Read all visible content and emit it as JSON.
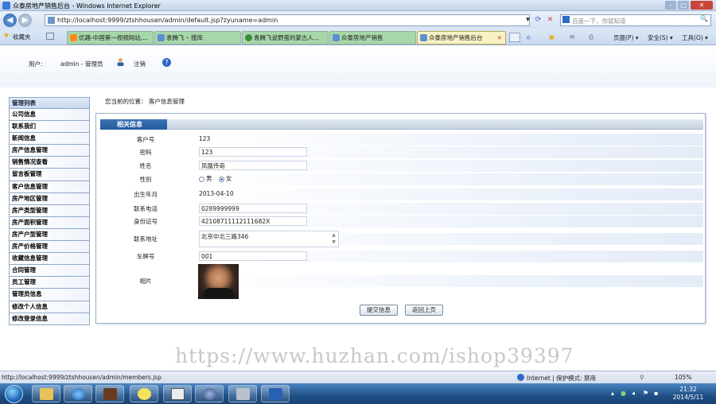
{
  "window": {
    "title": "众泰房地产销售后台 - Windows Internet Explorer",
    "min": "–",
    "max": "□",
    "close": "✕"
  },
  "address": {
    "url": "http://localhost:9999/ztshhousen/admin/default.jsp?zyuname=admin",
    "search_placeholder": "百度一下，你就知道",
    "back": "◀",
    "forward": "▶",
    "dropdown": "▾",
    "refresh": "⟳",
    "stop": "✕",
    "search_icon": "🔍"
  },
  "favorites": {
    "label": "收藏夹"
  },
  "tabs": [
    {
      "label": "优趣-中国第一视频网站,...",
      "color": "#a6d7a8"
    },
    {
      "label": "袁腾飞 – 搜库",
      "color": "#a6d7a8"
    },
    {
      "label": "袁腾飞说野蛮的蒙古人...",
      "color": "#a6d7a8"
    },
    {
      "label": "众泰房地产销售",
      "color": "#a6d7a8"
    },
    {
      "label": "众泰房地产销售后台",
      "color": "#f7f1c3",
      "active": true
    }
  ],
  "tab_close": "✕",
  "toolbar": {
    "page": "页面(P) ▾",
    "safety": "安全(S) ▾",
    "tools": "工具(O) ▾"
  },
  "header": {
    "user_label": "用户:",
    "user_value": "admin - 管理员",
    "logout": "注销",
    "help": "?"
  },
  "sidebar": {
    "title": "管理列表",
    "items": [
      "公司信息",
      "联系我们",
      "新闻信息",
      "房产信息管理",
      "销售情况查看",
      "留言板管理",
      "客户信息管理",
      "房产地区管理",
      "房产类型管理",
      "房产面积管理",
      "房产户型管理",
      "房产价格管理",
      "收藏信息管理",
      "合同管理",
      "员工管理",
      "管理员信息",
      "修改个人信息",
      "修改登录信息"
    ]
  },
  "breadcrumb": "您当前的位置：  客户信息管理",
  "panel": {
    "title": "相关信息"
  },
  "form": {
    "customer_no": {
      "label": "客户号",
      "value": "123"
    },
    "password": {
      "label": "密码",
      "value": "123"
    },
    "name": {
      "label": "姓名",
      "value": "凤凰传奇"
    },
    "gender": {
      "label": "性别",
      "male": "男",
      "female": "女",
      "selected": "女"
    },
    "birth": {
      "label": "出生年月",
      "value": "2013-04-10"
    },
    "phone": {
      "label": "联系电话",
      "value": "0289999999"
    },
    "id_card": {
      "label": "身份证号",
      "value": "42108711112111682X"
    },
    "address": {
      "label": "联系地址",
      "value": "北京中北三路346"
    },
    "plate": {
      "label": "车牌号",
      "value": "001"
    },
    "photo": {
      "label": "相片"
    }
  },
  "buttons": {
    "submit": "提交信息",
    "back": "返回上页"
  },
  "watermark": "https://www.huzhan.com/ishop39397",
  "statusbar": {
    "url": "http://localhost:9999/ztshhousen/admin/members.jsp",
    "zone": "Internet | 保护模式: 禁用",
    "zoom": "105%"
  },
  "taskbar": {
    "time": "21:32",
    "date": "2014/5/11"
  },
  "colors": {
    "sidebar_border": "#8ea8c8",
    "panel_tab": "#2a62a6",
    "accent": "#3a7bd5"
  }
}
